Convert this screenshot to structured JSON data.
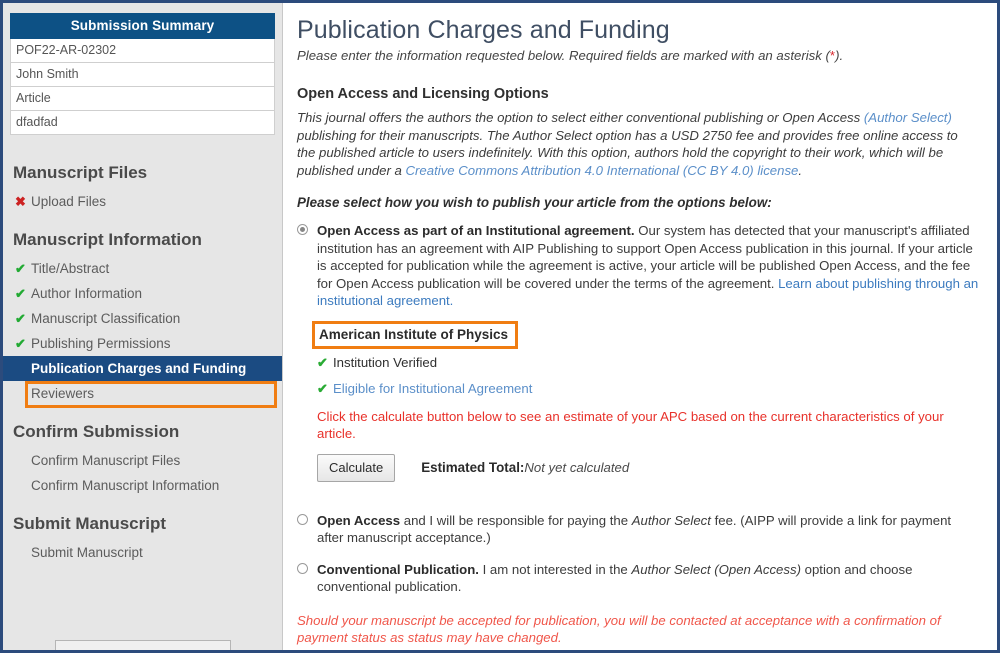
{
  "sidebar": {
    "summary": {
      "header": "Submission Summary",
      "rows": [
        "POF22-AR-02302",
        "John Smith",
        "Article",
        "dfadfad"
      ]
    },
    "groups": [
      {
        "title": "Manuscript Files",
        "items": [
          {
            "label": "Upload Files",
            "mark": "cross-icon",
            "state": "incomplete"
          }
        ]
      },
      {
        "title": "Manuscript Information",
        "items": [
          {
            "label": "Title/Abstract",
            "mark": "check-icon",
            "state": "complete"
          },
          {
            "label": "Author Information",
            "mark": "check-icon",
            "state": "complete"
          },
          {
            "label": "Manuscript Classification",
            "mark": "check-icon",
            "state": "complete"
          },
          {
            "label": "Publishing Permissions",
            "mark": "check-icon",
            "state": "complete"
          },
          {
            "label": "Publication Charges and Funding",
            "mark": "none",
            "state": "selected"
          },
          {
            "label": "Reviewers",
            "mark": "none",
            "state": "default"
          }
        ]
      },
      {
        "title": "Confirm Submission",
        "items": [
          {
            "label": "Confirm Manuscript Files",
            "mark": "none",
            "state": "default"
          },
          {
            "label": "Confirm Manuscript Information",
            "mark": "none",
            "state": "default"
          }
        ]
      },
      {
        "title": "Submit Manuscript",
        "items": [
          {
            "label": "Submit Manuscript",
            "mark": "none",
            "state": "default"
          }
        ]
      }
    ]
  },
  "main": {
    "title": "Publication Charges and Funding",
    "subtitle_before": "Please enter the information requested below. Required fields are marked with an asterisk (",
    "subtitle_star": "*",
    "subtitle_after": ").",
    "section_title": "Open Access and Licensing Options",
    "intro": {
      "part1": "This journal offers the authors the option to select either conventional publishing or Open Access ",
      "link1": "(Author Select)",
      "part2": " publishing for their manuscripts. The Author Select option has a USD 2750 fee and provides free online access to the published article to users indefinitely. With this option, authors hold the copyright to their work, which will be published under a ",
      "link2": "Creative Commons Attribution 4.0 International (CC BY 4.0) license",
      "part3": "."
    },
    "select_prompt": "Please select how you wish to publish your article from the options below:",
    "options": [
      {
        "id": "institutional-agreement",
        "selected": true,
        "bold": "Open Access as part of an Institutional agreement.",
        "text": " Our system has detected that your manuscript's affiliated institution has an agreement with AIP Publishing to support Open Access publication in this journal. If your article is accepted for publication while the agreement is active, your article will be published Open Access, and the fee for Open Access publication will be covered under the terms of the agreement. ",
        "link": "Learn about publishing through an institutional agreement."
      },
      {
        "id": "open-access-author-pays",
        "selected": false,
        "bold": "Open Access",
        "text_a": " and I will be responsible for paying the ",
        "italic": "Author Select",
        "text_b": " fee. (AIPP will provide a link for payment after manuscript acceptance.)"
      },
      {
        "id": "conventional-publication",
        "selected": false,
        "bold": "Conventional Publication.",
        "text_a": " I am not interested in the ",
        "italic": "Author Select (Open Access)",
        "text_b": " option and choose conventional publication."
      }
    ],
    "institution": {
      "name": "American Institute of Physics",
      "verified_label": "Institution Verified",
      "eligible_label": "Eligible for Institutional Agreement",
      "calculate_warning": "Click the calculate button below to see an estimate of your APC based on the current characteristics of your article.",
      "calculate_button": "Calculate",
      "estimated_total_label": "Estimated Total:",
      "estimated_total_value": "Not yet calculated"
    },
    "bottom_note": "Should your manuscript be accepted for publication, you will be contacted at acceptance with a confirmation of payment status as status may have changed."
  },
  "icons": {
    "check": "✔",
    "cross": "✖"
  },
  "colors": {
    "header_navy": "#0d5185",
    "selected_navy": "#1b4b82",
    "annotation_orange": "#f07d12",
    "check_green": "#2aab35",
    "cross_red": "#cc2222",
    "warning_red": "#e8312a",
    "link_blue": "#5b8fc9"
  }
}
